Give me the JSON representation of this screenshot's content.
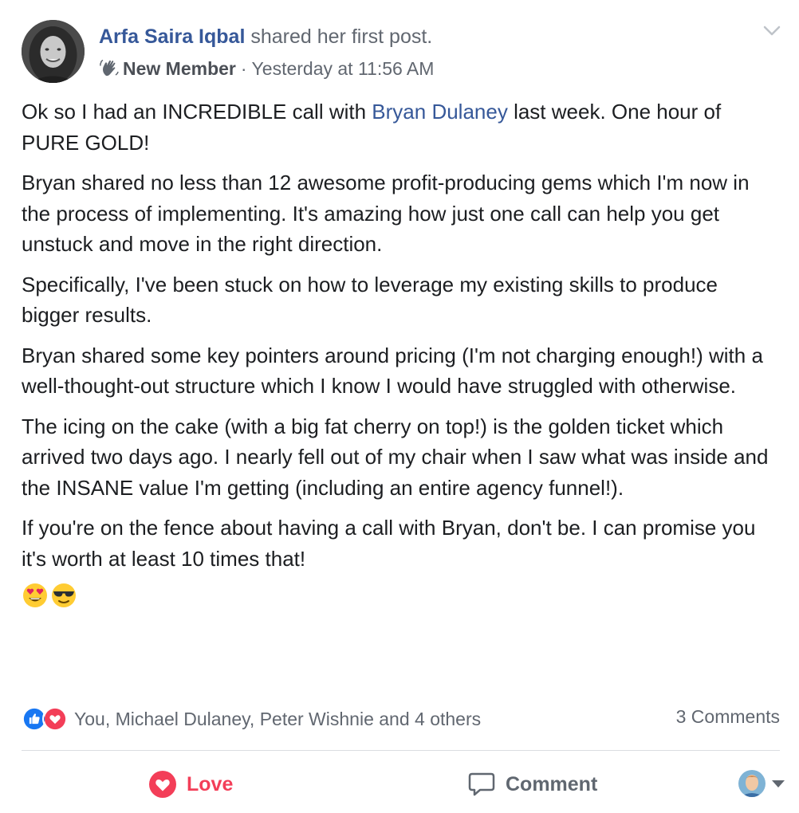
{
  "header": {
    "author_name": "Arfa Saira Iqbal",
    "action_text": " shared her first post.",
    "badge_label": "New Member",
    "separator": "·",
    "timestamp": "Yesterday at 11:56 AM",
    "badge_icon": "wave-icon",
    "menu_icon": "chevron-down-icon"
  },
  "body": {
    "p1_before": "Ok so I had an INCREDIBLE call with ",
    "p1_mention": "Bryan Dulaney",
    "p1_after": " last week. One hour of PURE GOLD!",
    "p2": "Bryan shared no less than 12 awesome profit-producing gems which I'm now in the process of implementing. It's amazing how just one call can help you get unstuck and move in the right direction.",
    "p3": "Specifically, I've been stuck on how to leverage my existing skills to produce bigger results.",
    "p4": "Bryan shared some key pointers around pricing (I'm not charging enough!) with a well-thought-out structure which I know I would have struggled with otherwise.",
    "p5": "The icing on the cake (with a big fat cherry on top!) is the golden ticket which arrived two days ago. I nearly fell out of my chair when I saw what was inside and the INSANE value I'm getting (including an entire agency funnel!).",
    "p6": "If you're on the fence about having a call with Bryan, don't be. I can promise you it's worth at least 10 times that!",
    "emojis": [
      "heart-eyes-emoji",
      "sunglasses-emoji"
    ]
  },
  "reactions": {
    "icons": [
      "like-reaction-icon",
      "love-reaction-icon"
    ],
    "names": "You, Michael Dulaney, Peter Wishnie and 4 others",
    "comments": "3 Comments"
  },
  "actions": {
    "love_label": "Love",
    "comment_label": "Comment"
  },
  "colors": {
    "link": "#365899",
    "love": "#f33e58",
    "like": "#1877f2",
    "muted": "#616770",
    "text": "#1c1e21"
  }
}
